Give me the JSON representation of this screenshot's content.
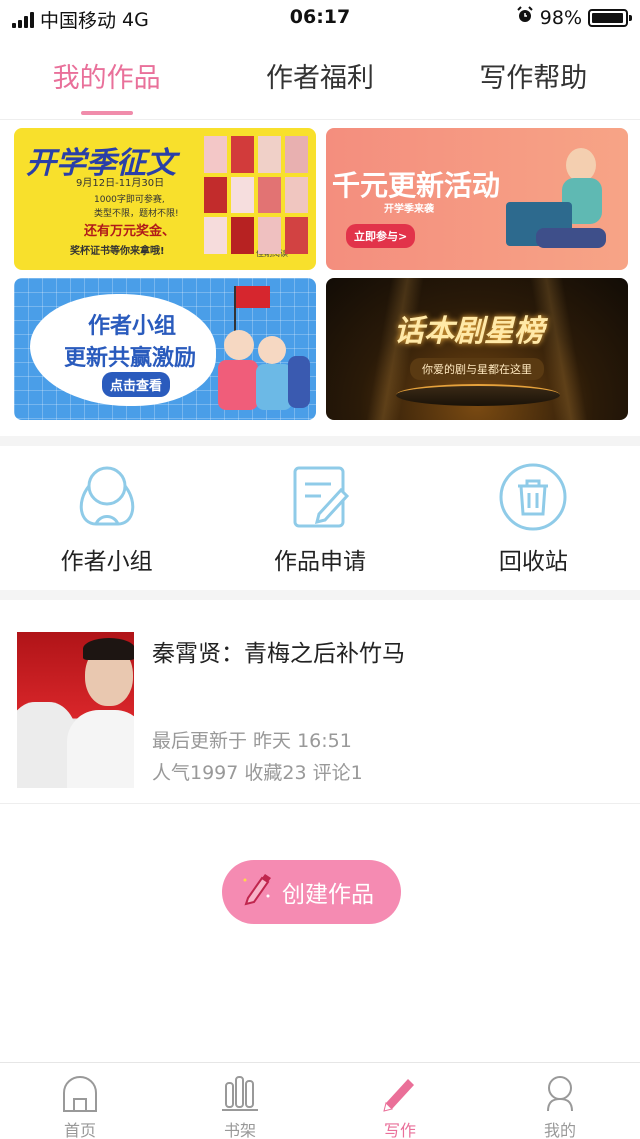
{
  "status_bar": {
    "carrier": "中国移动",
    "network": "4G",
    "time": "06:17",
    "battery": "98%"
  },
  "top_tabs": [
    {
      "label": "我的作品",
      "active": true
    },
    {
      "label": "作者福利",
      "active": false
    },
    {
      "label": "写作帮助",
      "active": false
    }
  ],
  "banners": [
    {
      "title": "开学季征文",
      "subtitle": "9月12日-11月30日",
      "line1": "1000字即可参赛,",
      "line2": "类型不限，题材不限!",
      "line3": "还有万元奖金、",
      "line4": "奖杯证书等你来拿哦!",
      "brand": "佳期阅读"
    },
    {
      "title": "千元更新活动",
      "subtitle": "开学季来袭",
      "button": "立即参与>"
    },
    {
      "title": "作者小组",
      "subtitle": "更新共赢激励",
      "button": "点击查看"
    },
    {
      "title": "话本剧星榜",
      "subtitle": "你爱的剧与星都在这里"
    }
  ],
  "tools": [
    {
      "label": "作者小组",
      "icon": "author-group-icon"
    },
    {
      "label": "作品申请",
      "icon": "apply-edit-icon"
    },
    {
      "label": "回收站",
      "icon": "trash-icon"
    }
  ],
  "work": {
    "title": "秦霄贤：青梅之后补竹马",
    "updated": "最后更新于 昨天 16:51",
    "stats": "人气1997 收藏23 评论1"
  },
  "create_button": {
    "label": "创建作品",
    "icon": "pen-icon"
  },
  "bottom_nav": [
    {
      "label": "首页",
      "icon": "home-icon",
      "active": false
    },
    {
      "label": "书架",
      "icon": "bookshelf-icon",
      "active": false
    },
    {
      "label": "写作",
      "icon": "write-pen-icon",
      "active": true
    },
    {
      "label": "我的",
      "icon": "profile-icon",
      "active": false
    }
  ],
  "colors": {
    "accent": "#e9709a",
    "button": "#f58bb2",
    "tool_icon": "#8fcbe8"
  }
}
